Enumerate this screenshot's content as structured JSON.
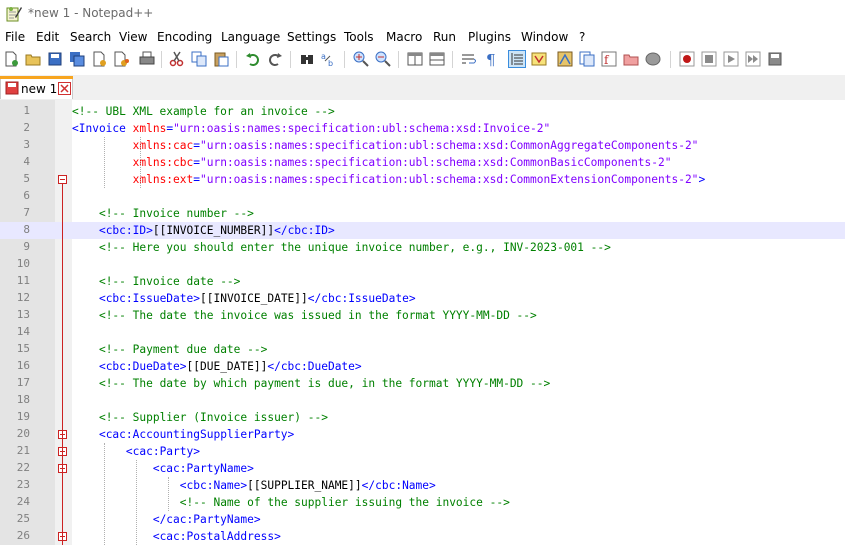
{
  "window": {
    "title": "*new 1 - Notepad++"
  },
  "menu": [
    "File",
    "Edit",
    "Search",
    "View",
    "Encoding",
    "Language",
    "Settings",
    "Tools",
    "Macro",
    "Run",
    "Plugins",
    "Window",
    "?"
  ],
  "tabs": [
    {
      "label": "new 1",
      "active": true
    }
  ],
  "toolbar_icons": [
    "new-file-icon",
    "open-file-icon",
    "save-icon",
    "save-all-icon",
    "close-icon",
    "close-all-icon",
    "print-icon",
    "cut-icon",
    "copy-icon",
    "paste-icon",
    "undo-icon",
    "redo-icon",
    "find-icon",
    "replace-icon",
    "zoom-in-icon",
    "zoom-out-icon",
    "sync-vertical-icon",
    "sync-horizontal-icon",
    "word-wrap-icon",
    "show-all-chars-icon",
    "indent-guide-icon",
    "udl-icon",
    "doc-map-icon",
    "doc-list-icon",
    "function-list-icon",
    "folder-workspace-icon",
    "monitoring-icon",
    "record-macro-icon",
    "stop-record-icon",
    "play-macro-icon",
    "play-multiple-icon",
    "save-macro-icon"
  ],
  "colors": {
    "comment": "#008000",
    "tag": "#0000ff",
    "attribute": "#ff0000",
    "value": "#8000ff",
    "current_line": "#e8e8ff",
    "tab_accent": "#f7a51f"
  },
  "editor": {
    "current_line": 8,
    "lines": [
      {
        "n": "1",
        "tokens": [
          [
            "comment",
            "<!-- UBL XML example for an invoice -->"
          ]
        ]
      },
      {
        "n": "2",
        "tokens": [
          [
            "tag",
            "<Invoice "
          ],
          [
            "attr",
            "xmlns"
          ],
          [
            "tag",
            "="
          ],
          [
            "val",
            "\"urn:oasis:names:specification:ubl:schema:xsd:Invoice-2\""
          ]
        ]
      },
      {
        "n": "3",
        "tokens": [
          [
            "text",
            "         "
          ],
          [
            "attr",
            "xmlns:cac"
          ],
          [
            "tag",
            "="
          ],
          [
            "val",
            "\"urn:oasis:names:specification:ubl:schema:xsd:CommonAggregateComponents-2\""
          ]
        ]
      },
      {
        "n": "4",
        "tokens": [
          [
            "text",
            "         "
          ],
          [
            "attr",
            "xmlns:cbc"
          ],
          [
            "tag",
            "="
          ],
          [
            "val",
            "\"urn:oasis:names:specification:ubl:schema:xsd:CommonBasicComponents-2\""
          ]
        ]
      },
      {
        "n": "5",
        "tokens": [
          [
            "text",
            "         "
          ],
          [
            "attr",
            "xmlns:ext"
          ],
          [
            "tag",
            "="
          ],
          [
            "val",
            "\"urn:oasis:names:specification:ubl:schema:xsd:CommonExtensionComponents-2\""
          ],
          [
            "tag",
            ">"
          ]
        ]
      },
      {
        "n": "6",
        "tokens": []
      },
      {
        "n": "7",
        "tokens": [
          [
            "text",
            "    "
          ],
          [
            "comment",
            "<!-- Invoice number -->"
          ]
        ]
      },
      {
        "n": "8",
        "tokens": [
          [
            "text",
            "    "
          ],
          [
            "tag",
            "<cbc:ID>"
          ],
          [
            "text",
            "[[INVOICE_NUMBER]]"
          ],
          [
            "tag",
            "</cbc:ID>"
          ]
        ]
      },
      {
        "n": "9",
        "tokens": [
          [
            "text",
            "    "
          ],
          [
            "comment",
            "<!-- Here you should enter the unique invoice number, e.g., INV-2023-001 -->"
          ]
        ]
      },
      {
        "n": "10",
        "tokens": []
      },
      {
        "n": "11",
        "tokens": [
          [
            "text",
            "    "
          ],
          [
            "comment",
            "<!-- Invoice date -->"
          ]
        ]
      },
      {
        "n": "12",
        "tokens": [
          [
            "text",
            "    "
          ],
          [
            "tag",
            "<cbc:IssueDate>"
          ],
          [
            "text",
            "[[INVOICE_DATE]]"
          ],
          [
            "tag",
            "</cbc:IssueDate>"
          ]
        ]
      },
      {
        "n": "13",
        "tokens": [
          [
            "text",
            "    "
          ],
          [
            "comment",
            "<!-- The date the invoice was issued in the format YYYY-MM-DD -->"
          ]
        ]
      },
      {
        "n": "14",
        "tokens": []
      },
      {
        "n": "15",
        "tokens": [
          [
            "text",
            "    "
          ],
          [
            "comment",
            "<!-- Payment due date -->"
          ]
        ]
      },
      {
        "n": "16",
        "tokens": [
          [
            "text",
            "    "
          ],
          [
            "tag",
            "<cbc:DueDate>"
          ],
          [
            "text",
            "[[DUE_DATE]]"
          ],
          [
            "tag",
            "</cbc:DueDate>"
          ]
        ]
      },
      {
        "n": "17",
        "tokens": [
          [
            "text",
            "    "
          ],
          [
            "comment",
            "<!-- The date by which payment is due, in the format YYYY-MM-DD -->"
          ]
        ]
      },
      {
        "n": "18",
        "tokens": []
      },
      {
        "n": "19",
        "tokens": [
          [
            "text",
            "    "
          ],
          [
            "comment",
            "<!-- Supplier (Invoice issuer) -->"
          ]
        ]
      },
      {
        "n": "20",
        "tokens": [
          [
            "text",
            "    "
          ],
          [
            "tag",
            "<cac:AccountingSupplierParty>"
          ]
        ]
      },
      {
        "n": "21",
        "tokens": [
          [
            "text",
            "        "
          ],
          [
            "tag",
            "<cac:Party>"
          ]
        ]
      },
      {
        "n": "22",
        "tokens": [
          [
            "text",
            "            "
          ],
          [
            "tag",
            "<cac:PartyName>"
          ]
        ]
      },
      {
        "n": "23",
        "tokens": [
          [
            "text",
            "                "
          ],
          [
            "tag",
            "<cbc:Name>"
          ],
          [
            "text",
            "[[SUPPLIER_NAME]]"
          ],
          [
            "tag",
            "</cbc:Name>"
          ]
        ]
      },
      {
        "n": "24",
        "tokens": [
          [
            "text",
            "                "
          ],
          [
            "comment",
            "<!-- Name of the supplier issuing the invoice -->"
          ]
        ]
      },
      {
        "n": "25",
        "tokens": [
          [
            "text",
            "            "
          ],
          [
            "tag",
            "</cac:PartyName>"
          ]
        ]
      },
      {
        "n": "26",
        "tokens": [
          [
            "text",
            "            "
          ],
          [
            "tag",
            "<cac:PostalAddress>"
          ]
        ]
      }
    ]
  }
}
